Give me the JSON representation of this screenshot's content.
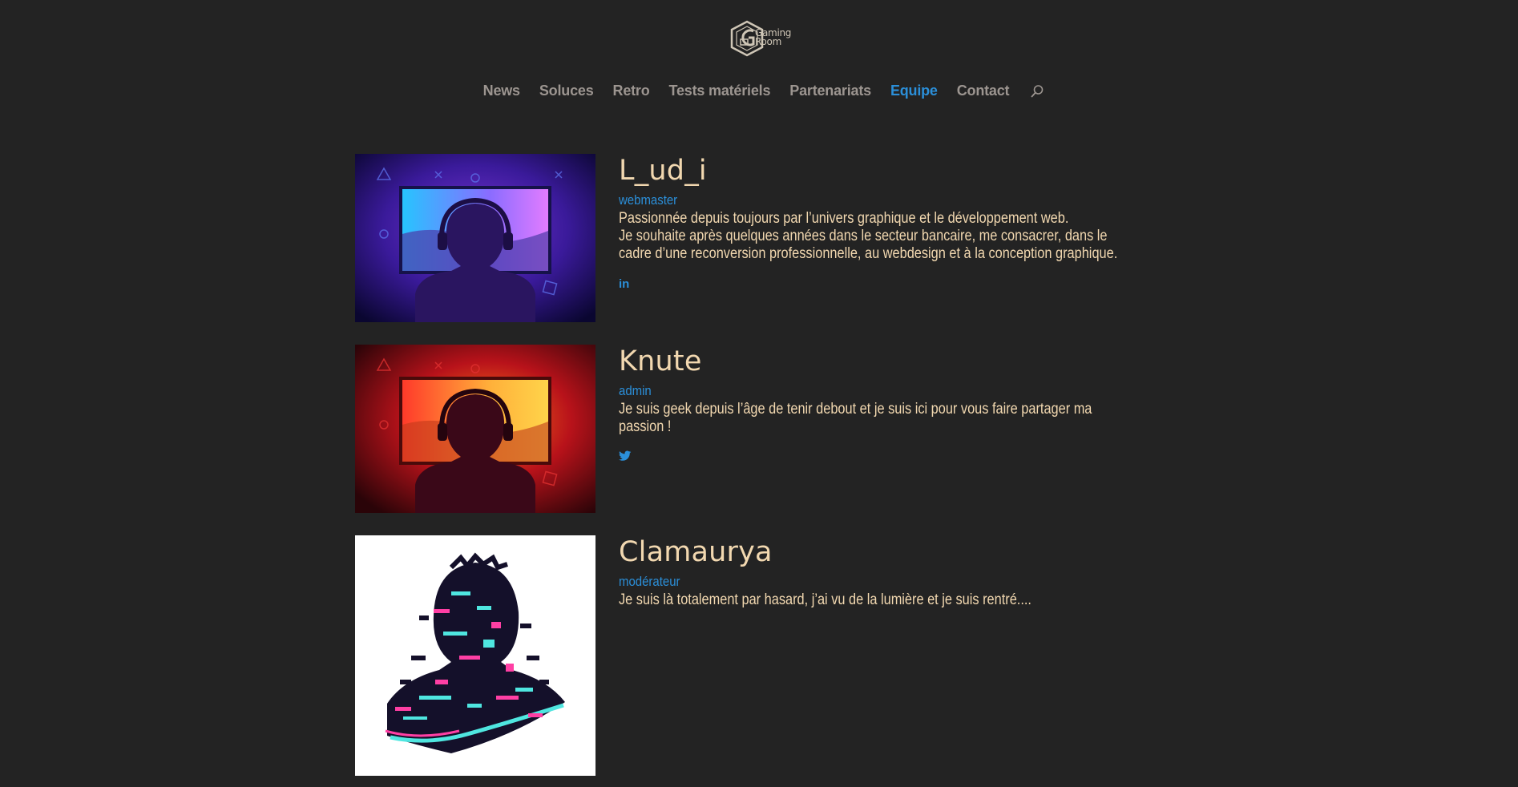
{
  "site": {
    "logo_text_line1": "Gaming",
    "logo_text_line2": "Room"
  },
  "nav": {
    "items": [
      {
        "label": "News"
      },
      {
        "label": "Soluces"
      },
      {
        "label": "Retro"
      },
      {
        "label": "Tests matériels"
      },
      {
        "label": "Partenariats"
      },
      {
        "label": "Equipe",
        "active": true
      },
      {
        "label": "Contact"
      }
    ],
    "search_icon": "search-icon"
  },
  "members": [
    {
      "name": "L_ud_i",
      "role": "webmaster",
      "bio": [
        "Passionnée depuis toujours par l’univers graphique et le développement web.",
        "Je souhaite après quelques années dans le secteur bancaire, me consacrer, dans le",
        "cadre d’une reconversion professionnelle, au webdesign et à la conception  graphique."
      ],
      "social_icon": "linkedin-icon",
      "social_text": "in"
    },
    {
      "name": "Knute",
      "role": "admin",
      "bio": [
        "Je suis geek depuis l’âge de tenir debout et je suis ici pour vous faire partager ma",
        "passion !"
      ],
      "social_icon": "twitter-icon"
    },
    {
      "name": "Clamaurya",
      "role": "modérateur",
      "bio": [
        "Je suis là totalement par hasard, j’ai vu de la lumière et je suis rentré...."
      ]
    }
  ],
  "colors": {
    "background": "#232323",
    "text": "#f2d8b0",
    "accent": "#2b8fd9",
    "nav_text": "#9c9590"
  }
}
